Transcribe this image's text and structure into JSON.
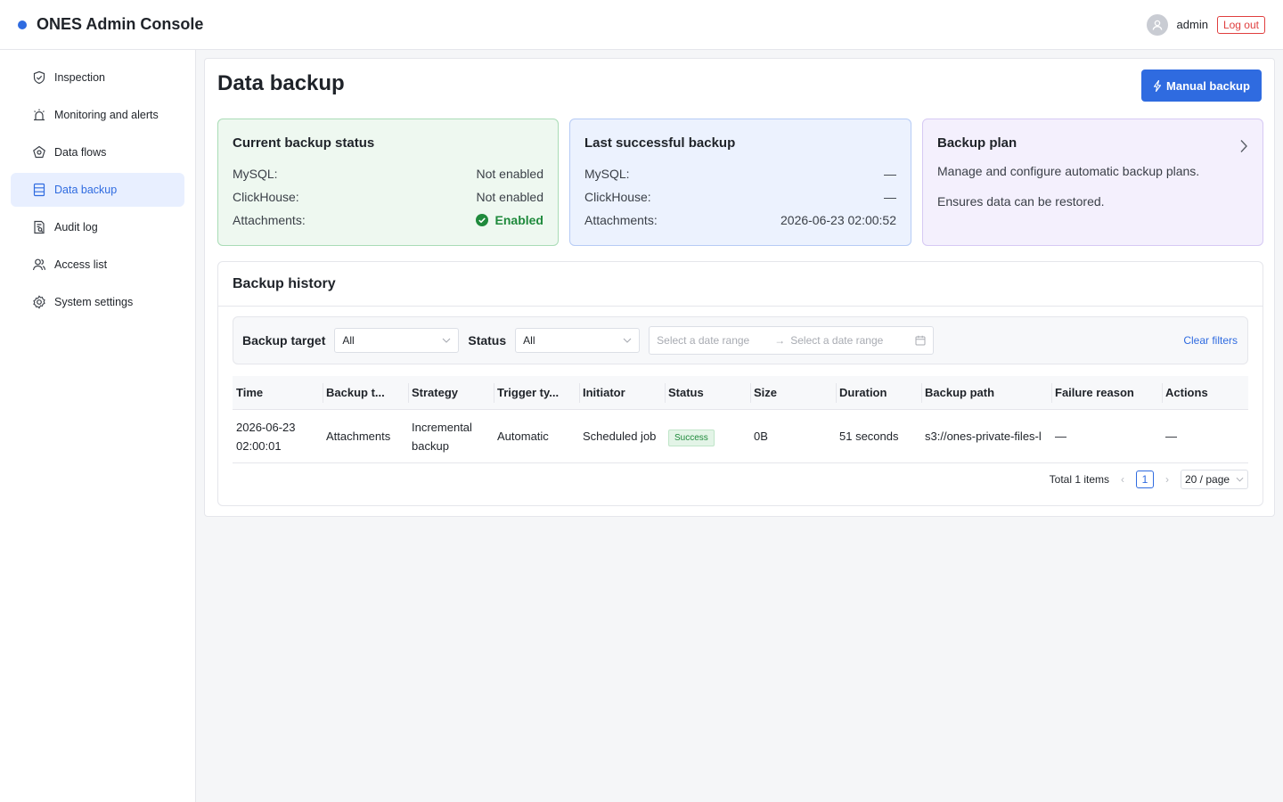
{
  "header": {
    "title": "ONES Admin Console",
    "username": "admin",
    "logout_label": "Log out"
  },
  "sidebar": {
    "items": [
      {
        "label": "Inspection",
        "icon": "shield-check-icon"
      },
      {
        "label": "Monitoring and alerts",
        "icon": "alarm-icon"
      },
      {
        "label": "Data flows",
        "icon": "network-icon"
      },
      {
        "label": "Data backup",
        "icon": "database-icon",
        "active": true
      },
      {
        "label": "Audit log",
        "icon": "audit-document-icon"
      },
      {
        "label": "Access list",
        "icon": "users-icon"
      },
      {
        "label": "System settings",
        "icon": "gear-icon"
      }
    ]
  },
  "page": {
    "title": "Data backup",
    "manual_backup_label": "Manual backup"
  },
  "current_status": {
    "title": "Current backup status",
    "rows": [
      {
        "label": "MySQL:",
        "value": "Not enabled"
      },
      {
        "label": "ClickHouse:",
        "value": "Not enabled"
      },
      {
        "label": "Attachments:",
        "value": "Enabled"
      }
    ]
  },
  "last_backup": {
    "title": "Last successful backup",
    "rows": [
      {
        "label": "MySQL:",
        "value": "—"
      },
      {
        "label": "ClickHouse:",
        "value": "—"
      },
      {
        "label": "Attachments:",
        "value": "2026-06-23 02:00:52"
      }
    ]
  },
  "backup_plan": {
    "title": "Backup plan",
    "line1": "Manage and configure automatic backup plans.",
    "line2": "Ensures data can be restored."
  },
  "history": {
    "title": "Backup history",
    "filters": {
      "target_label": "Backup target",
      "target_value": "All",
      "status_label": "Status",
      "status_value": "All",
      "date_start_placeholder": "Select a date range",
      "date_end_placeholder": "Select a date range",
      "clear_label": "Clear filters"
    },
    "columns": [
      "Time",
      "Backup t...",
      "Strategy",
      "Trigger ty...",
      "Initiator",
      "Status",
      "Size",
      "Duration",
      "Backup path",
      "Failure reason",
      "Actions"
    ],
    "rows": [
      {
        "time_date": "2026-06-23",
        "time_clock": "02:00:01",
        "target": "Attachments",
        "strategy_1": "Incremental",
        "strategy_2": "backup",
        "trigger": "Automatic",
        "initiator": "Scheduled job",
        "status": "Success",
        "size": "0B",
        "duration": "51 seconds",
        "path": "s3://ones-private-files-l",
        "failure": "—",
        "actions": "—"
      }
    ],
    "pagination": {
      "total": "Total 1 items",
      "current": "1",
      "page_size": "20 / page"
    }
  },
  "colors": {
    "primary": "#2f6be0",
    "success": "#1f8a3c",
    "danger": "#e03e3e"
  }
}
